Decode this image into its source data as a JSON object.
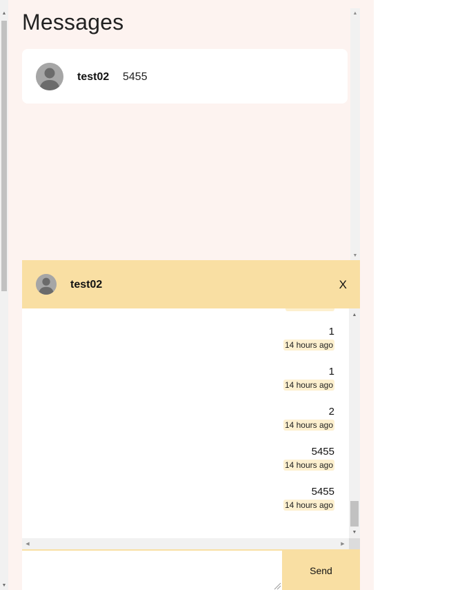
{
  "page": {
    "title": "Messages"
  },
  "conversations": [
    {
      "name": "test02",
      "preview": "5455",
      "avatar_icon": "default-user-avatar-icon"
    }
  ],
  "chat": {
    "name": "test02",
    "close_label": "X",
    "messages": [
      {
        "text": "1",
        "time": "14 hours ago"
      },
      {
        "text": "1",
        "time": "14 hours ago"
      },
      {
        "text": "2",
        "time": "14 hours ago"
      },
      {
        "text": "5455",
        "time": "14 hours ago"
      },
      {
        "text": "5455",
        "time": "14 hours ago"
      }
    ],
    "input_value": "",
    "send_label": "Send"
  },
  "colors": {
    "pane_bg": "#fdf3f0",
    "accent": "#f9dfa3",
    "time_badge": "#fdf0cf"
  }
}
